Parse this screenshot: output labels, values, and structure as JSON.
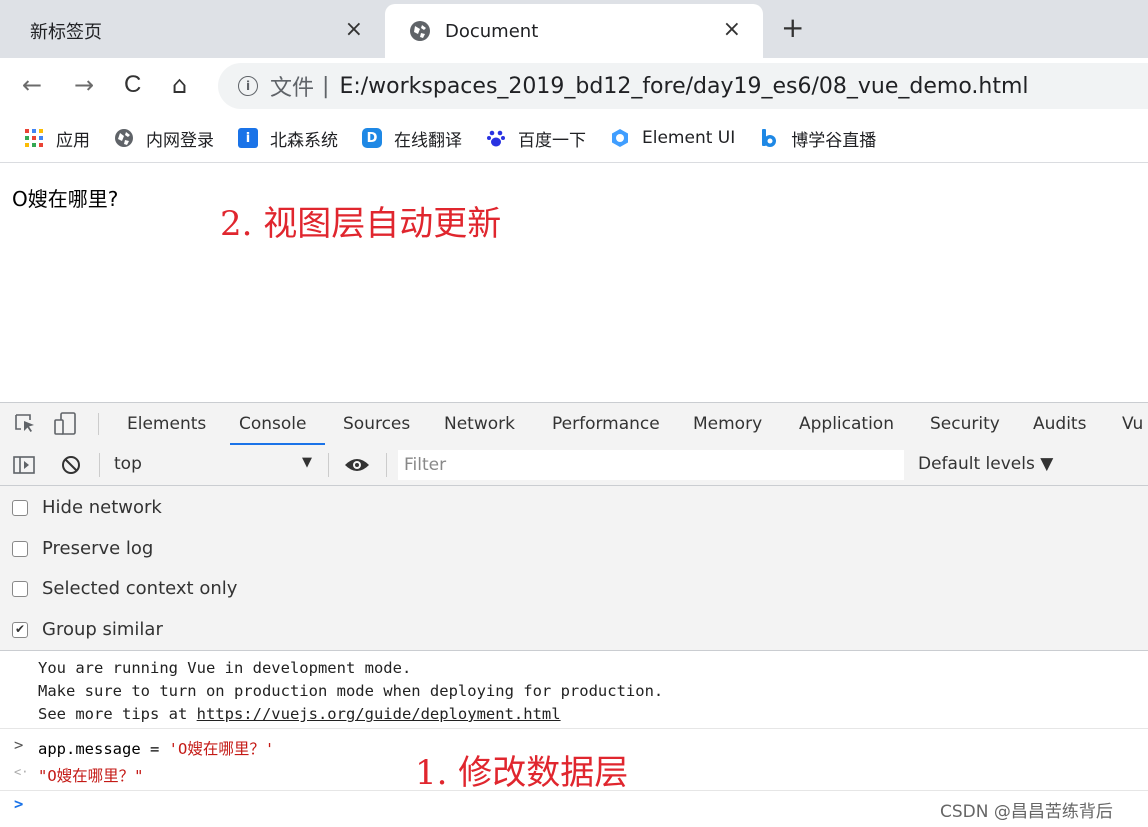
{
  "browser": {
    "tabs": [
      {
        "label": "新标签页",
        "active": false
      },
      {
        "label": "Document",
        "active": true
      }
    ],
    "close_glyph": "×",
    "new_tab_glyph": "+",
    "nav": {
      "back": "←",
      "forward": "→",
      "reload": "C",
      "home": "⌂"
    },
    "omnibox": {
      "info_glyph": "i",
      "label": "文件",
      "separator": "|",
      "url": "E:/workspaces_2019_bd12_fore/day19_es6/08_vue_demo.html"
    },
    "bookmarks": [
      {
        "label": "应用",
        "icon": "apps-grid-icon"
      },
      {
        "label": "内网登录",
        "icon": "globe-icon"
      },
      {
        "label": "北森系统",
        "icon": "info-badge-icon"
      },
      {
        "label": "在线翻译",
        "icon": "d-badge-icon"
      },
      {
        "label": "百度一下",
        "icon": "paw-icon"
      },
      {
        "label": "Element UI",
        "icon": "element-logo-icon"
      },
      {
        "label": "博学谷直播",
        "icon": "b-logo-icon"
      }
    ]
  },
  "page": {
    "message": "O嫂在哪里?"
  },
  "annotations": {
    "view_update": "2. 视图层自动更新",
    "data_update": "1. 修改数据层"
  },
  "devtools": {
    "tabs": [
      "Elements",
      "Console",
      "Sources",
      "Network",
      "Performance",
      "Memory",
      "Application",
      "Security",
      "Audits",
      "Vu"
    ],
    "active_tab": "Console",
    "context": "top",
    "filter_placeholder": "Filter",
    "levels": "Default levels ▼",
    "settings": [
      {
        "label": "Hide network",
        "checked": false
      },
      {
        "label": "Preserve log",
        "checked": false
      },
      {
        "label": "Selected context only",
        "checked": false
      },
      {
        "label": "Group similar",
        "checked": true
      }
    ],
    "vue_message": {
      "line1": "You are running Vue in development mode.",
      "line2": "Make sure to turn on production mode when deploying for production.",
      "line3_prefix": "See more tips at ",
      "line3_link": "https://vuejs.org/guide/deployment.html"
    },
    "input_line": {
      "prompt": ">",
      "code": "app.message = ",
      "value": "'O嫂在哪里？'"
    },
    "output_line": {
      "prompt": "<·",
      "value": "\"O嫂在哪里？\""
    },
    "empty_prompt": ">"
  },
  "watermark": "CSDN @昌昌苦练背后"
}
